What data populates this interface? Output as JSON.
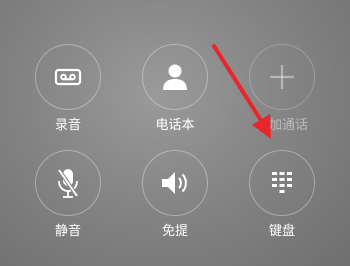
{
  "buttons": {
    "record": {
      "label": "录音",
      "icon": "cassette-icon",
      "enabled": true
    },
    "contacts": {
      "label": "电话本",
      "icon": "person-icon",
      "enabled": true
    },
    "add_call": {
      "label": "添加通话",
      "icon": "plus-icon",
      "enabled": false
    },
    "mute": {
      "label": "静音",
      "icon": "mic-muted-icon",
      "enabled": true
    },
    "speaker": {
      "label": "免提",
      "icon": "speaker-icon",
      "enabled": true
    },
    "keypad": {
      "label": "键盘",
      "icon": "keypad-icon",
      "enabled": true
    }
  },
  "annotation": {
    "type": "arrow",
    "target": "keypad",
    "color": "#e8262b"
  }
}
